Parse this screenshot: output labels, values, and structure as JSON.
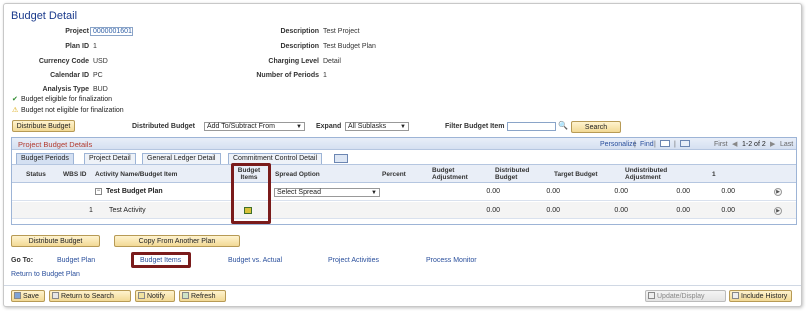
{
  "page_title": "Budget Detail",
  "fields": {
    "project_label": "Project",
    "project_value": "0000001601",
    "plan_id_label": "Plan ID",
    "plan_id_value": "1",
    "currency_label": "Currency Code",
    "currency_value": "USD",
    "calendar_label": "Calendar ID",
    "calendar_value": "PC",
    "analysis_label": "Analysis Type",
    "analysis_value": "BUD",
    "desc1_label": "Description",
    "desc1_value": "Test Project",
    "desc2_label": "Description",
    "desc2_value": "Test Budget Plan",
    "charging_label": "Charging Level",
    "charging_value": "Detail",
    "periods_label": "Number of Periods",
    "periods_value": "1"
  },
  "status": {
    "eligible": "Budget eligible for finalization",
    "not_eligible": "Budget not eligible for finalization"
  },
  "controls": {
    "distribute_budget_btn": "Distribute Budget",
    "distributed_budget_label": "Distributed Budget",
    "distributed_budget_value": "Add To/Subtract From",
    "expand_label": "Expand",
    "expand_value": "All Sublasks",
    "filter_label": "Filter Budget Item",
    "filter_value": "",
    "search_btn": "Search"
  },
  "grid": {
    "title": "Project Budget Details",
    "personalize": "Personalize",
    "find": "Find",
    "first": "First",
    "range": "1-2 of 2",
    "last": "Last",
    "tabs": [
      "Budget Periods",
      "Project Detail",
      "General Ledger Detail",
      "Commitment Control Detail"
    ],
    "columns": {
      "status": "Status",
      "wbs_id": "WBS ID",
      "activity": "Activity Name/Budget Item",
      "budget_items": "Budget Items",
      "spread_option": "Spread Option",
      "percent": "Percent",
      "budget_adjustment": "Budget Adjustment",
      "distributed_budget": "Distributed Budget",
      "target_budget": "Target Budget",
      "undistributed_adjustment": "Undistributed Adjustment",
      "period": "1"
    },
    "rows": [
      {
        "wbs_id": "",
        "activity": "Test Budget Plan",
        "expand": "−",
        "spread_option": "Select Spread",
        "budget_adjustment": "0.00",
        "distributed_budget": "0.00",
        "target_budget": "0.00",
        "undistributed_adjustment": "0.00",
        "period": "0.00"
      },
      {
        "wbs_id": "1",
        "activity": "Test Activity",
        "expand": "",
        "spread_option": "",
        "budget_adjustment": "0.00",
        "distributed_budget": "0.00",
        "target_budget": "0.00",
        "undistributed_adjustment": "0.00",
        "period": "0.00"
      }
    ]
  },
  "bottom_buttons": {
    "distribute_budget": "Distribute Budget",
    "copy_plan": "Copy From Another Plan"
  },
  "goto": {
    "label": "Go To:",
    "links": [
      "Budget Plan",
      "Budget Items",
      "Budget vs. Actual",
      "Project Activities",
      "Process Monitor"
    ],
    "return": "Return to Budget Plan"
  },
  "toolbar": {
    "save": "Save",
    "return_search": "Return to Search",
    "notify": "Notify",
    "refresh": "Refresh",
    "update_display": "Update/Display",
    "include_history": "Include History"
  },
  "colors": {
    "title": "#1a3a8c",
    "link": "#2a4f9c",
    "highlight": "#7a1b1b",
    "button": "#f2d995"
  }
}
